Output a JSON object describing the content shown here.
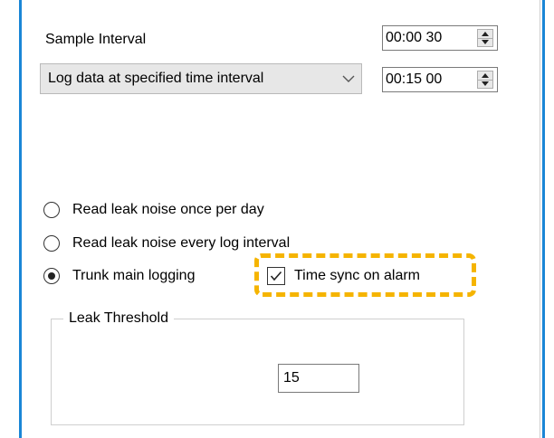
{
  "sample": {
    "label": "Sample Interval",
    "interval_value": "00:00 30"
  },
  "log_mode": {
    "selected": "Log data at specified time interval",
    "interval_value": "00:15 00"
  },
  "options": {
    "radio_once_label": "Read leak noise once per day",
    "radio_every_label": "Read leak noise every log interval",
    "radio_trunk_label": "Trunk main logging",
    "time_sync_label": "Time sync on alarm"
  },
  "leak": {
    "group_title": "Leak Threshold",
    "threshold_value": "15"
  },
  "colors": {
    "window_border": "#1a86d6",
    "highlight": "#f5b400"
  }
}
